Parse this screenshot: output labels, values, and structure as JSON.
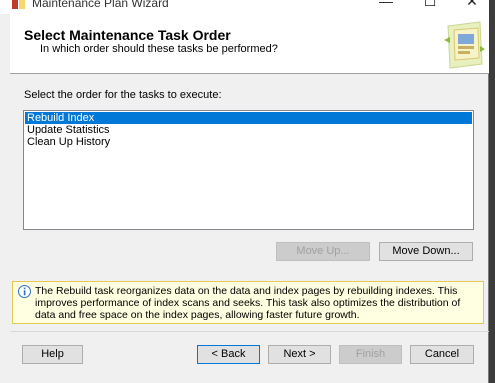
{
  "window": {
    "title": "Maintenance Plan Wizard",
    "minimize_glyph": "—",
    "maximize_glyph": "☐",
    "close_glyph": "✕"
  },
  "header": {
    "title": "Select Maintenance Task Order",
    "subtitle": "In which order should these tasks be performed?"
  },
  "main": {
    "list_label": "Select the order for the tasks to execute:",
    "tasks": [
      {
        "label": "Rebuild Index",
        "selected": true
      },
      {
        "label": "Update Statistics",
        "selected": false
      },
      {
        "label": "Clean Up History",
        "selected": false
      }
    ],
    "move_up_label": "Move Up...",
    "move_down_label": "Move Down..."
  },
  "info": {
    "text": "The Rebuild task reorganizes data on the data and index pages by rebuilding indexes. This improves performance of index scans and seeks. This task also optimizes the distribution of data and free space on the index pages, allowing faster future growth."
  },
  "footer": {
    "help_label": "Help",
    "back_label": "< Back",
    "next_label": "Next >",
    "finish_label": "Finish",
    "cancel_label": "Cancel"
  },
  "colors": {
    "selection": "#0078d7",
    "info_background": "#ffffe1",
    "info_border": "#e3c94f"
  }
}
